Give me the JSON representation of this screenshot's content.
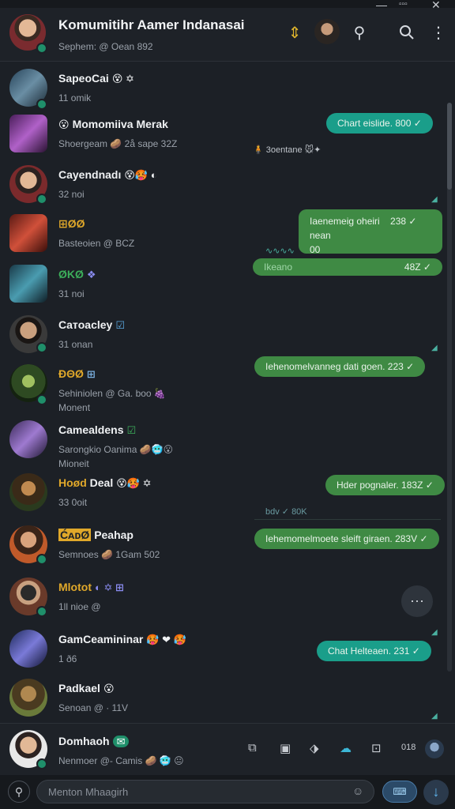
{
  "window": {
    "minimize": "—",
    "maximize": "▫▫▫",
    "close": "✕"
  },
  "header": {
    "title": "Komumitihr Aamer Indanasai",
    "subtitle": "Sephem: @ Oean 892",
    "icons": [
      "pin-icon",
      "avatar",
      "call-icon",
      "search-icon",
      "more-vert-icon"
    ]
  },
  "chats": [
    {
      "name": "SapeoCai",
      "name_emoji": "😵 ✡",
      "sub": "11 omik"
    },
    {
      "name": "Momomiiva Merak",
      "name_prefix_emoji": "😮",
      "sub": "Shoergeam  🥔 2å sape  32Z"
    },
    {
      "name": "Cayendnadı",
      "name_emoji": "😵🥵 ◐",
      "sub": "32 noi"
    },
    {
      "name": "",
      "tag": "⊞ØØ",
      "sub": "Basteoien @ BCZ"
    },
    {
      "name": "",
      "tag": "ØKØ",
      "tag_color": "#3cae5a",
      "name_emoji": "❖",
      "sub": "31 noi"
    },
    {
      "name": "Caтoacley",
      "name_emoji": "☑",
      "sub": "31 onan"
    },
    {
      "name": "",
      "tag": "ĐΘØ",
      "name_emoji": "⊞",
      "sub": "Sehiniolen @ Ga. boo 🍇",
      "sub2": "Monent"
    },
    {
      "name": "Camealdens",
      "name_emoji": "☑",
      "sub": "Sarongkio Oanima  🥔🥶😮",
      "sub2": "Mioneit"
    },
    {
      "name": "Deal",
      "tag": "Hoød",
      "name_emoji": "😵🥵 ✡",
      "sub": "33 0oit"
    },
    {
      "name": "Peahap",
      "tag": "ĆᴀᴅØ",
      "sub": "Semnoes 🥔 1Gam 502"
    },
    {
      "name": "",
      "tag": "Mlotot",
      "name_emoji": "◐ ✡ ⊞",
      "sub": "1ll nioe @"
    },
    {
      "name": "GamCeamininar",
      "name_emoji": "🥵 ❤ 🥵",
      "sub": "1 ð6"
    },
    {
      "name": "Padkael",
      "name_emoji": "😮",
      "sub": "Senoan @ · 11V"
    },
    {
      "name": "Domhaoh",
      "name_emoji": "✉",
      "sub": "Nenmoer @- Camis  🥔 🥶 😐"
    }
  ],
  "bubbles": {
    "b1": "Chart eislide. 800 ✓",
    "b1_meta": "🧍 3oentane  🐭✦",
    "b2": "Iaenemeig oheiri    238 ✓\nnean\n00",
    "b3_left": "Ikeano",
    "b3_right": "48Z ✓",
    "b4": "Iehenomelvanneg dati goen.   223 ✓",
    "b5": "Hder pognaler.   183Z ✓",
    "b5_meta": "bdv  ✓   80K",
    "b6": "Iehemomelmoete sleift giraen.   283V ✓",
    "b7": "Chat Helteaen.   231 ✓"
  },
  "bottom_icons": [
    "frame-icon",
    "chat-icon",
    "tag-icon",
    "cloud-icon",
    "image-icon",
    "status-text"
  ],
  "bottom_status": "018",
  "compose": {
    "placeholder": "Menton Mhaagirh",
    "keyboard_label": "⌨"
  },
  "colors": {
    "bubble_green": "#3f8a44",
    "bubble_teal": "#1a9e8a",
    "accent": "#e0b52c"
  }
}
